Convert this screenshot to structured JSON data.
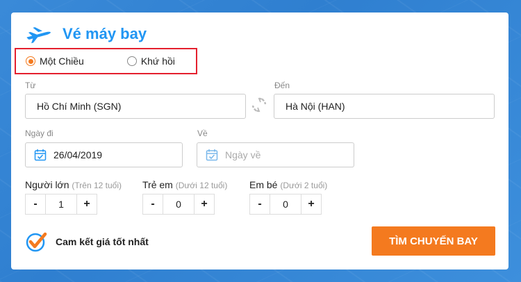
{
  "header": {
    "title": "Vé máy bay",
    "icon": "plane-icon"
  },
  "trip_type": {
    "options": [
      {
        "label": "Một Chiều",
        "selected": true
      },
      {
        "label": "Khứ hồi",
        "selected": false
      }
    ]
  },
  "route": {
    "from_label": "Từ",
    "from_value": "Hồ Chí Minh (SGN)",
    "to_label": "Đến",
    "to_value": "Hà Nội (HAN)"
  },
  "dates": {
    "depart_label": "Ngày đi",
    "depart_value": "26/04/2019",
    "return_label": "Về",
    "return_placeholder": "Ngày về"
  },
  "passengers": {
    "adult": {
      "label": "Người lớn",
      "hint": "(Trên 12 tuổi)",
      "count": "1"
    },
    "child": {
      "label": "Trẻ em",
      "hint": "(Dưới 12 tuổi)",
      "count": "0"
    },
    "infant": {
      "label": "Em bé",
      "hint": "(Dưới 2 tuổi)",
      "count": "0"
    },
    "minus": "-",
    "plus": "+"
  },
  "guarantee": {
    "text": "Cam kết giá tốt nhất"
  },
  "search_button": {
    "label": "TÌM CHUYẾN BAY"
  },
  "colors": {
    "accent": "#2196f3",
    "cta": "#f47a1f",
    "highlight_border": "#e4202e"
  }
}
